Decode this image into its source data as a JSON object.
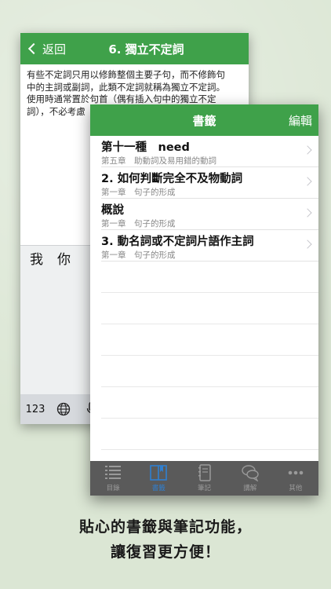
{
  "back_screen": {
    "nav": {
      "back_label": "返回",
      "title": "6. 獨立不定詞"
    },
    "body_lines": [
      "有些不定詞只用以修飾整個主要子句，而不修飾句",
      "中的主詞或副詞，此類不定詞就稱為獨立不定詞。",
      "使用時通常置於句首（偶有插入句中的獨立不定",
      "詞），不必考慮"
    ],
    "keyboard": {
      "suggestions": [
        "我",
        "你"
      ],
      "key_123": "123",
      "globe_icon": "globe-icon",
      "mic_icon": "microphone-icon"
    }
  },
  "front_screen": {
    "nav": {
      "title": "書籤",
      "edit_label": "編輯"
    },
    "bookmarks": [
      {
        "title": "第十一種　need",
        "subtitle": "第五章　助動詞及易用錯的動詞"
      },
      {
        "title": "2. 如何判斷完全不及物動詞",
        "subtitle": "第一章　句子的形成"
      },
      {
        "title": "概說",
        "subtitle": "第一章　句子的形成"
      },
      {
        "title": "3. 動名詞或不定詞片語作主詞",
        "subtitle": "第一章　句子的形成"
      }
    ],
    "tabs": [
      {
        "label": "目錄",
        "icon": "list-icon",
        "active": false
      },
      {
        "label": "書籤",
        "icon": "book-icon",
        "active": true
      },
      {
        "label": "筆記",
        "icon": "notebook-icon",
        "active": false
      },
      {
        "label": "講解",
        "icon": "chat-bubbles-icon",
        "active": false
      },
      {
        "label": "其他",
        "icon": "more-icon",
        "active": false
      }
    ]
  },
  "caption": {
    "line1": "貼心的書籤與筆記功能，",
    "line2": "讓復習更方便！"
  },
  "colors": {
    "nav_green": "#3fa14a",
    "tab_active": "#2f7fd0",
    "tabbar_bg": "#5a5a5a",
    "background": "#dbe6d4"
  }
}
